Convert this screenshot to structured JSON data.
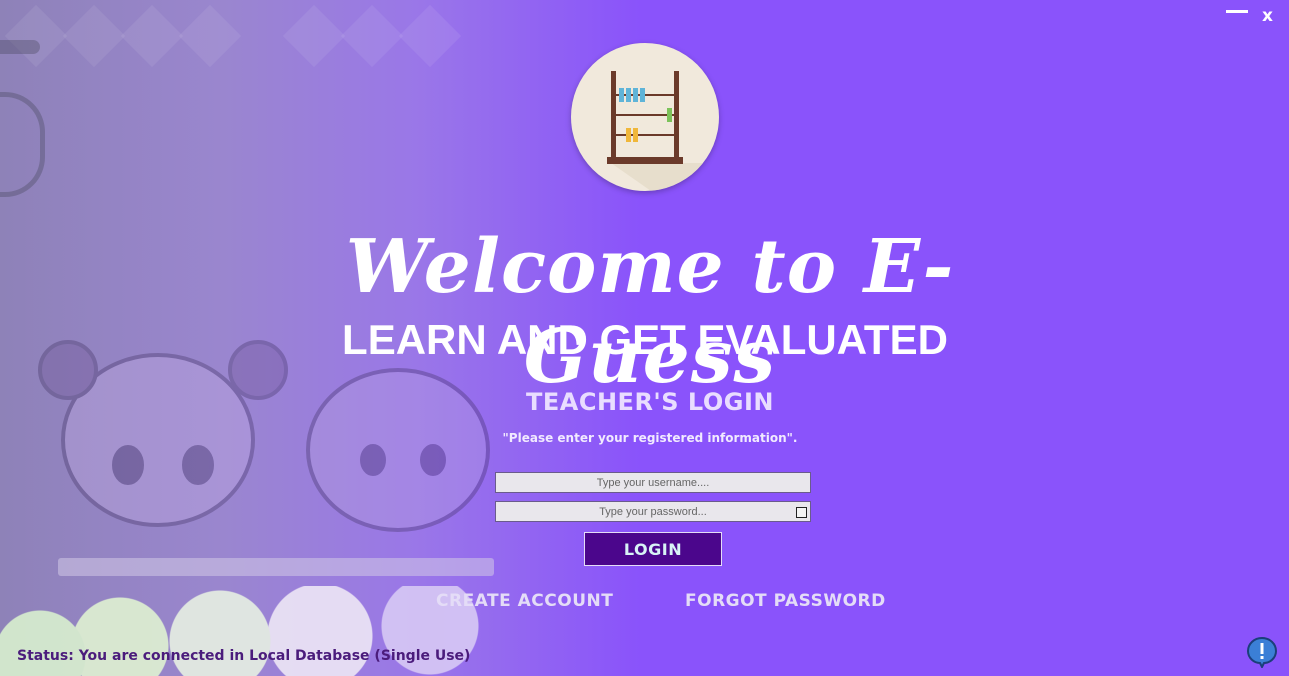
{
  "window": {
    "minimize_icon": "minimize-icon",
    "close_label": "x"
  },
  "logo": {
    "icon": "abacus-icon"
  },
  "hero": {
    "title": "Welcome to E-Guess",
    "subtitle": "LEARN AND GET EVALUATED"
  },
  "login": {
    "heading": "TEACHER'S LOGIN",
    "hint": "\"Please enter your registered information\".",
    "username_placeholder": "Type your username....",
    "password_placeholder": "Type your password...",
    "login_label": "LOGIN",
    "create_account_label": "CREATE ACCOUNT",
    "forgot_password_label": "FORGOT PASSWORD"
  },
  "status": {
    "text": "Status: You are connected in Local Database (Single Use)"
  },
  "help": {
    "icon": "exclamation-bubble-icon"
  },
  "colors": {
    "background": "#8a53fb",
    "login_button": "#4b068c",
    "status_text": "#4b1c7c"
  }
}
